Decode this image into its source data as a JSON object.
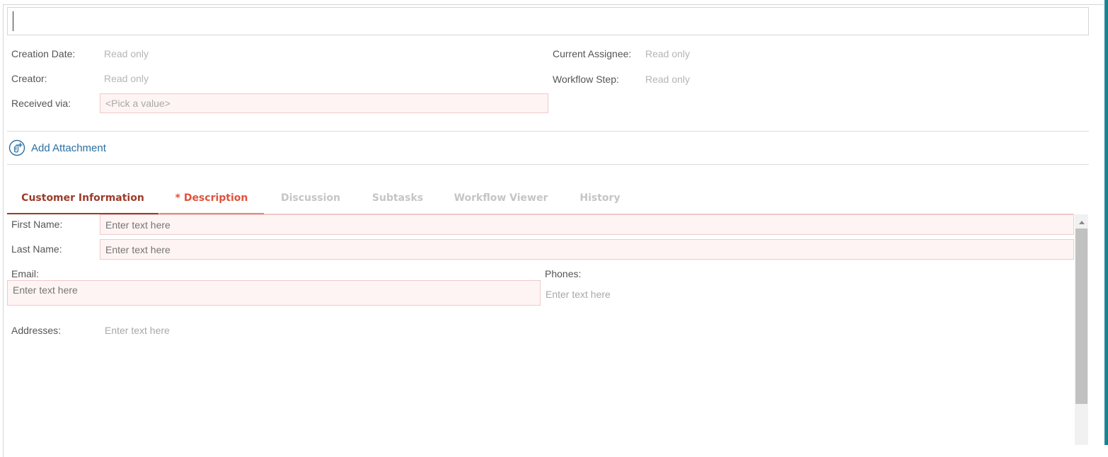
{
  "title_field": {
    "value": ""
  },
  "meta": {
    "creation_date": {
      "label": "Creation Date:",
      "value": "Read only"
    },
    "creator": {
      "label": "Creator:",
      "value": "Read only"
    },
    "received_via": {
      "label": "Received via:",
      "placeholder": "<Pick a value>"
    },
    "current_assignee": {
      "label": "Current Assignee:",
      "value": "Read only"
    },
    "workflow_step": {
      "label": "Workflow Step:",
      "value": "Read only"
    }
  },
  "attachment": {
    "label": "Add Attachment",
    "icon": "attachment-add-icon"
  },
  "tabs": [
    {
      "label": "Customer Information",
      "state": "active"
    },
    {
      "label": "* Description",
      "state": "required"
    },
    {
      "label": "Discussion",
      "state": "inactive"
    },
    {
      "label": "Subtasks",
      "state": "inactive"
    },
    {
      "label": "Workflow Viewer",
      "state": "inactive"
    },
    {
      "label": "History",
      "state": "inactive"
    }
  ],
  "customer_form": {
    "first_name": {
      "label": "First Name:",
      "placeholder": "Enter text here"
    },
    "last_name": {
      "label": "Last Name:",
      "placeholder": "Enter text here"
    },
    "email": {
      "label": "Email:",
      "placeholder": "Enter text here"
    },
    "phones": {
      "label": "Phones:",
      "placeholder": "Enter text here"
    },
    "addresses": {
      "label": "Addresses:",
      "placeholder": "Enter text here"
    }
  },
  "colors": {
    "accent_tab": "#9c3b2a",
    "required_tab": "#e0523a",
    "required_field_bg": "#fff4f4",
    "link": "#2a6fa3",
    "side_bar": "#117d8f"
  }
}
